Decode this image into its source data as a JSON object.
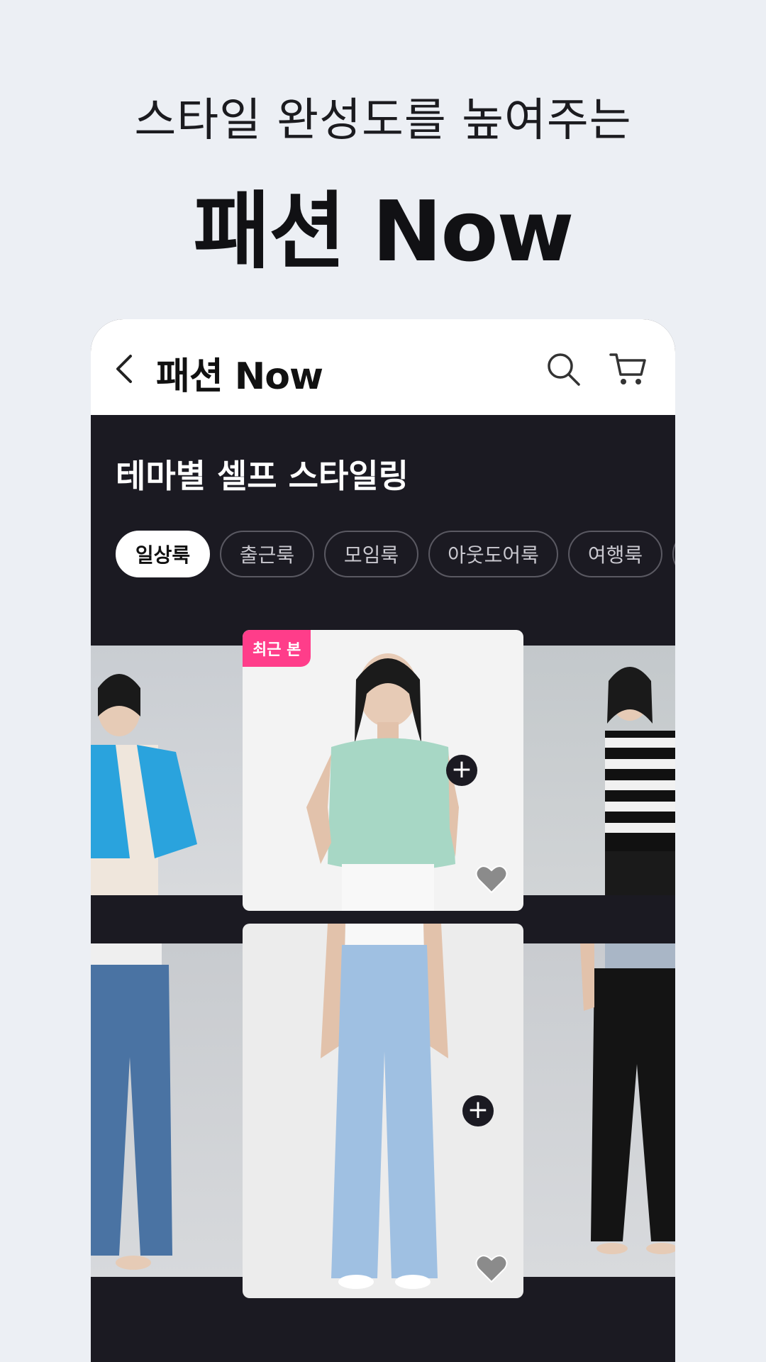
{
  "promo": {
    "subtitle": "스타일 완성도를 높여주는",
    "title": "패션 Now"
  },
  "appbar": {
    "title": "패션 Now",
    "back_icon": "chevron-left-icon",
    "search_icon": "search-icon",
    "cart_icon": "cart-icon"
  },
  "section": {
    "title": "테마별 셀프 스타일링"
  },
  "chips": [
    {
      "label": "일상룩",
      "active": true
    },
    {
      "label": "출근룩",
      "active": false
    },
    {
      "label": "모임룩",
      "active": false
    },
    {
      "label": "아웃도어룩",
      "active": false
    },
    {
      "label": "여행룩",
      "active": false
    }
  ],
  "cards": {
    "top_badge": "최근 본"
  },
  "colors": {
    "background": "#eceff4",
    "dark": "#1b1a22",
    "badge": "#ff3d8a"
  }
}
